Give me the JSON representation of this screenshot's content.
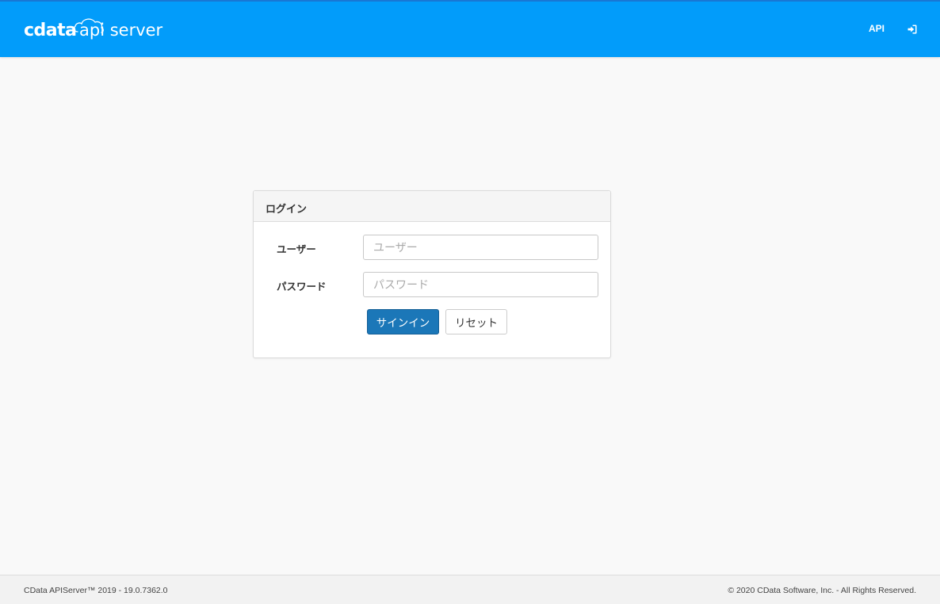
{
  "header": {
    "logo_text": "cdata api server",
    "nav": {
      "api_label": "API",
      "signin_icon": "sign-in-icon"
    },
    "colors": {
      "bar": "#029cfa",
      "bar_border": "#1877d4"
    }
  },
  "login": {
    "title": "ログイン",
    "user": {
      "label": "ユーザー",
      "placeholder": "ユーザー",
      "value": ""
    },
    "password": {
      "label": "パスワード",
      "placeholder": "パスワード",
      "value": ""
    },
    "signin_button": "サインイン",
    "reset_button": "リセット",
    "colors": {
      "primary_button": "#1b77b8"
    }
  },
  "footer": {
    "version": "CData APIServer™ 2019 - 19.0.7362.0",
    "copyright": "© 2020 CData Software, Inc. - All Rights Reserved."
  }
}
